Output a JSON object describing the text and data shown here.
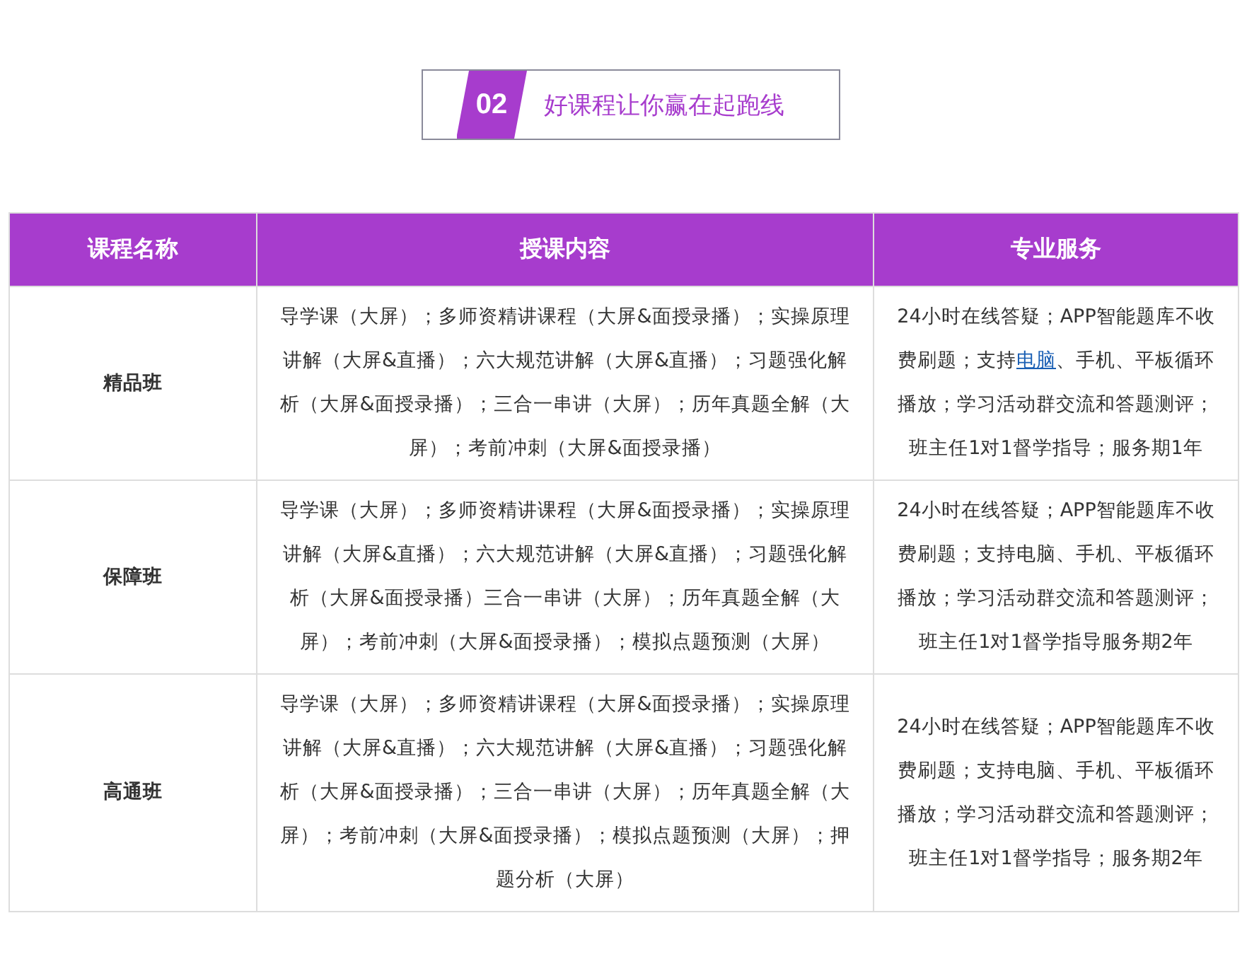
{
  "heading": {
    "number": "02",
    "title": "好课程让你赢在起跑线"
  },
  "table": {
    "columns": [
      "课程名称",
      "授课内容",
      "专业服务"
    ],
    "rows": [
      {
        "name": "精品班",
        "content": "导学课（大屏）；多师资精讲课程（大屏&面授录播）；实操原理讲解（大屏&直播）；六大规范讲解（大屏&直播）；习题强化解析（大屏&面授录播）；三合一串讲（大屏）；历年真题全解（大屏）；考前冲刺（大屏&面授录播）",
        "service": [
          {
            "kind": "text",
            "text": "24小时在线答疑；APP智能题库不收费刷题；支持"
          },
          {
            "kind": "link",
            "text": "电脑"
          },
          {
            "kind": "text",
            "text": "、手机、平板循环播放；学习活动群交流和答题测评；班主任1对1督学指导；服务期1年"
          }
        ]
      },
      {
        "name": "保障班",
        "content": "导学课（大屏）；多师资精讲课程（大屏&面授录播）；实操原理讲解（大屏&直播）；六大规范讲解（大屏&直播）；习题强化解析（大屏&面授录播）三合一串讲（大屏）；历年真题全解（大屏）；考前冲刺（大屏&面授录播）；模拟点题预测（大屏）",
        "service": [
          {
            "kind": "text",
            "text": "24小时在线答疑；APP智能题库不收费刷题；支持电脑、手机、平板循环播放；学习活动群交流和答题测评；班主任1对1督学指导服务期2年"
          }
        ]
      },
      {
        "name": "高通班",
        "content": "导学课（大屏）；多师资精讲课程（大屏&面授录播）；实操原理讲解（大屏&直播）；六大规范讲解（大屏&直播）；习题强化解析（大屏&面授录播）；三合一串讲（大屏）；历年真题全解（大屏）；考前冲刺（大屏&面授录播）；模拟点题预测（大屏）；押题分析（大屏）",
        "service": [
          {
            "kind": "text",
            "text": "24小时在线答疑；APP智能题库不收费刷题；支持电脑、手机、平板循环播放；学习活动群交流和答题测评；班主任1对1督学指导；服务期2年"
          }
        ]
      }
    ]
  }
}
